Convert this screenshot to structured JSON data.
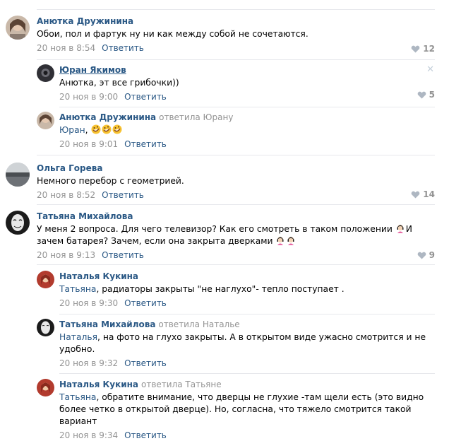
{
  "comments": [
    {
      "author": "Анютка Дружинина",
      "reply_to": "",
      "text": "Обои, пол и фартук ну ни как между собой не сочетаются.",
      "date": "20 ноя в 8:54",
      "reply": "Ответить",
      "likes": "12"
    },
    {
      "author": "Юран Якимов",
      "reply_to": "",
      "addressee": "",
      "text": "Анютка, эт все грибочки))",
      "date": "20 ноя в 9:00",
      "reply": "Ответить",
      "likes": "5"
    },
    {
      "author": "Анютка Дружинина",
      "reply_to": "ответила Юрану",
      "addressee": "Юран",
      "text": ",",
      "date": "20 ноя в 9:01",
      "reply": "Ответить",
      "likes": ""
    },
    {
      "author": "Ольга Горева",
      "reply_to": "",
      "text": "Немного перебор с геометрией.",
      "date": "20 ноя в 8:52",
      "reply": "Ответить",
      "likes": "14"
    },
    {
      "author": "Татьяна Михайлова",
      "reply_to": "",
      "text_1": "У меня 2 вопроса. Для чего телевизор? Как его смотреть в таком положении",
      "text_2": "И зачем батарея? Зачем, если она закрыта дверками",
      "date": "20 ноя в 9:13",
      "reply": "Ответить",
      "likes": "9"
    },
    {
      "author": "Наталья Кукина",
      "reply_to": "",
      "addressee": "Татьяна",
      "text": ", радиаторы закрыты \"не наглухо\"- тепло поступает .",
      "date": "20 ноя в 9:30",
      "reply": "Ответить",
      "likes": ""
    },
    {
      "author": "Татьяна Михайлова",
      "reply_to": "ответила Наталье",
      "addressee": "Наталья",
      "text": ", на фото на глухо закрыты. А в открытом виде ужасно смотрится и не удобно.",
      "date": "20 ноя в 9:32",
      "reply": "Ответить",
      "likes": ""
    },
    {
      "author": "Наталья Кукина",
      "reply_to": "ответила Татьяне",
      "addressee": "Татьяна",
      "text": ", обратите внимание, что дверцы не глухие -там щели есть (это видно более четко в открытой дверце). Но, согласна, что тяжело смотрится такой вариант",
      "date": "20 ноя в 9:34",
      "reply": "Ответить",
      "likes": ""
    }
  ],
  "colors": {
    "link": "#2a5885",
    "muted": "#939393",
    "divider": "#e7e8ec"
  },
  "icons": {
    "like": "heart-icon",
    "close": "close-icon",
    "laugh_emoji": "rofl-emoji",
    "girl_emoji": "girl-emoji"
  }
}
